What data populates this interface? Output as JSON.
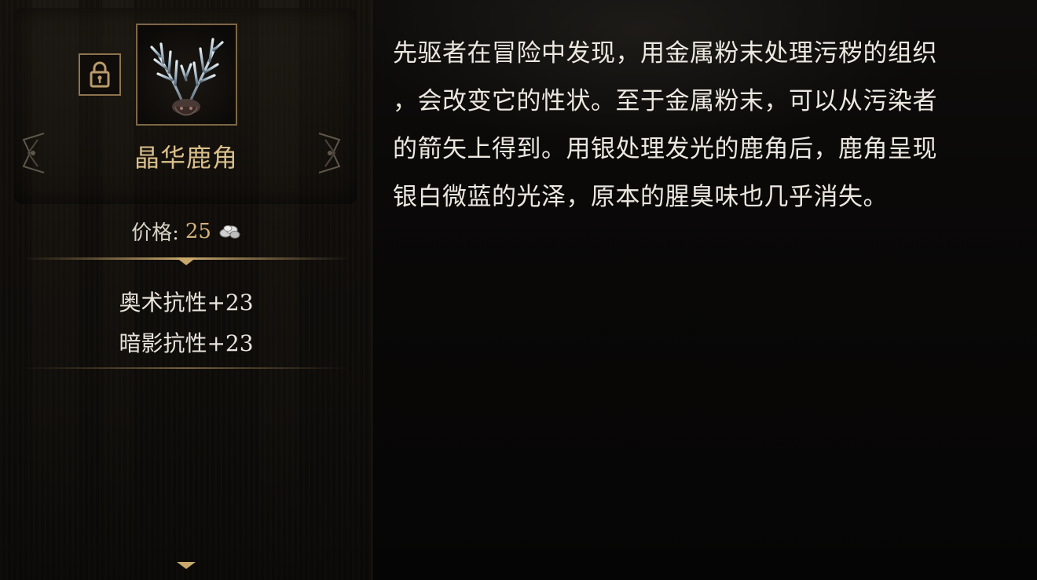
{
  "item": {
    "name": "晶华鹿角",
    "price_label": "价格:",
    "price_value": "25",
    "currency_icon": "silver-coins-icon",
    "image_icon": "crystal-antler-icon",
    "lock_icon": "padlock-icon"
  },
  "stats": [
    {
      "text": "奥术抗性+23"
    },
    {
      "text": "暗影抗性+23"
    }
  ],
  "description": "先驱者在冒险中发现，用金属粉末处理污秽的组织\n，会改变它的性状。至于金属粉末，可以从污染者\n的箭矢上得到。用银处理发光的鹿角后，鹿角呈现\n银白微蓝的光泽，原本的腥臭味也几乎消失。",
  "colors": {
    "name_gold": "#d9bf8a",
    "price_gold": "#d2b27a",
    "frame_bronze": "#8d744c",
    "text_light": "#ece8e0",
    "background": "#080706"
  }
}
